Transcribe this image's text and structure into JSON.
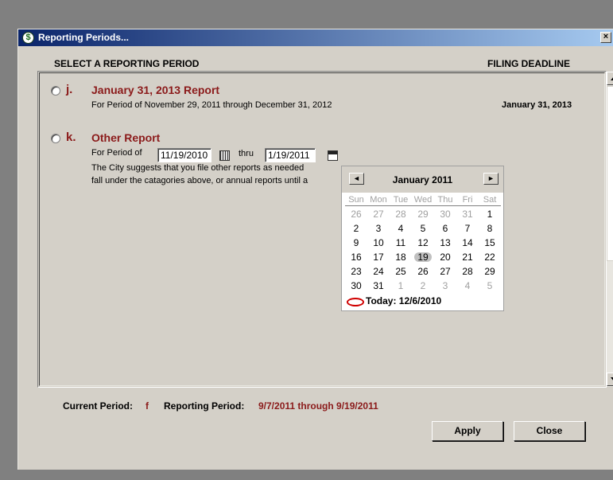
{
  "window": {
    "title": "Reporting Periods...",
    "close_glyph": "×"
  },
  "header": {
    "left": "SELECT A REPORTING PERIOD",
    "right": "FILING DEADLINE"
  },
  "options": [
    {
      "letter": "j.",
      "title": "January 31, 2013 Report",
      "desc": "For Period of November 29, 2011 through December 31, 2012",
      "deadline": "January 31, 2013"
    },
    {
      "letter": "k.",
      "title": "Other Report",
      "period_label": "For Period of",
      "from_date": "11/19/2010",
      "thru_label": "thru",
      "to_date": "1/19/2011",
      "desc_line1": "The City suggests that you file other reports as needed",
      "desc_line2": "fall under the catagories above, or annual reports until a"
    }
  ],
  "calendar": {
    "prev": "◄",
    "next": "►",
    "month": "January 2011",
    "dows": [
      "Sun",
      "Mon",
      "Tue",
      "Wed",
      "Thu",
      "Fri",
      "Sat"
    ],
    "weeks": [
      [
        "26",
        "27",
        "28",
        "29",
        "30",
        "31",
        "1"
      ],
      [
        "2",
        "3",
        "4",
        "5",
        "6",
        "7",
        "8"
      ],
      [
        "9",
        "10",
        "11",
        "12",
        "13",
        "14",
        "15"
      ],
      [
        "16",
        "17",
        "18",
        "19",
        "20",
        "21",
        "22"
      ],
      [
        "23",
        "24",
        "25",
        "26",
        "27",
        "28",
        "29"
      ],
      [
        "30",
        "31",
        "1",
        "2",
        "3",
        "4",
        "5"
      ]
    ],
    "selected": "19",
    "today": "Today: 12/6/2010"
  },
  "footer": {
    "current_label": "Current Period:",
    "current_value": "f",
    "reporting_label": "Reporting Period:",
    "reporting_value": "9/7/2011 through 9/19/2011"
  },
  "buttons": {
    "apply": "Apply",
    "close": "Close"
  },
  "colors": {
    "accent_text": "#8b1a1a",
    "titlebar": "#0a246a"
  }
}
